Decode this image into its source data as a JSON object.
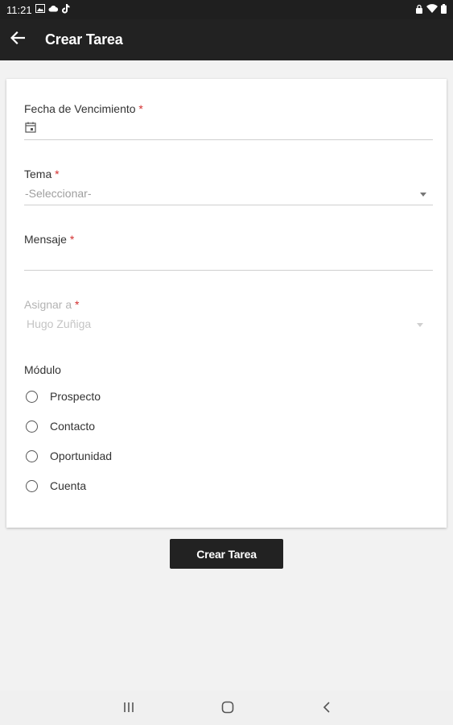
{
  "status_bar": {
    "time": "11:21",
    "left_icons": [
      "image-icon",
      "cloud-icon",
      "tiktok-icon"
    ],
    "right_icons": [
      "lock-icon",
      "wifi-icon",
      "battery-icon"
    ]
  },
  "app_bar": {
    "title": "Crear Tarea",
    "back_icon": "arrow-left-icon"
  },
  "form": {
    "due_date": {
      "label": "Fecha de Vencimiento",
      "required_mark": "*",
      "value": "",
      "icon": "calendar-icon"
    },
    "topic": {
      "label": "Tema",
      "required_mark": "*",
      "placeholder": "-Seleccionar-"
    },
    "message": {
      "label": "Mensaje",
      "required_mark": "*",
      "value": ""
    },
    "assign_to": {
      "label": "Asignar a",
      "required_mark": "*",
      "value": "Hugo Zuñiga",
      "disabled": true
    },
    "module": {
      "label": "Módulo",
      "options": [
        "Prospecto",
        "Contacto",
        "Oportunidad",
        "Cuenta"
      ],
      "selected": null
    }
  },
  "submit_button": {
    "label": "Crear Tarea"
  },
  "nav_bar": {
    "icons": [
      "recent-apps-icon",
      "home-icon",
      "back-nav-icon"
    ]
  },
  "colors": {
    "app_bar": "#222222",
    "required": "#d32f2f",
    "background": "#f2f2f2"
  }
}
